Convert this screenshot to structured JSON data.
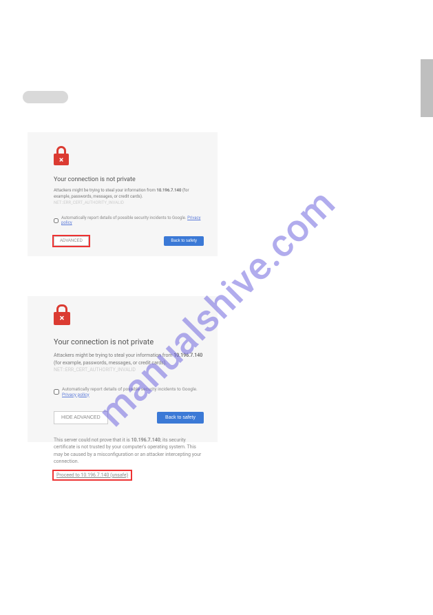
{
  "watermark": "manualshive.com",
  "panel1": {
    "heading": "Your connection is not private",
    "desc_pre": "Attackers might be trying to steal your information from ",
    "ip": "10.196.7.140",
    "desc_post": " (for example, passwords, messages, or credit cards). ",
    "errcode": "NET::ERR_CERT_AUTHORITY_INVALID",
    "check_label": "Automatically report details of possible security incidents to Google. ",
    "policy": "Privacy policy",
    "advanced": "ADVANCED",
    "safety": "Back to safety"
  },
  "panel2": {
    "heading": "Your connection is not private",
    "desc_pre": "Attackers might be trying to steal your information from ",
    "ip": "10.196.7.140",
    "desc_post": " (for example, passwords, messages, or credit cards). ",
    "errcode": "NET::ERR_CERT_AUTHORITY_INVALID",
    "check_label": "Automatically report details of possible security incidents to Google. ",
    "policy": "Privacy policy",
    "hide": "HIDE ADVANCED",
    "safety": "Back to safety",
    "explain_pre": "This server could not prove that it is ",
    "explain_ip": "10.196.7.140",
    "explain_post": "; its security certificate is not trusted by your computer's operating system. This may be caused by a misconfiguration or an attacker intercepting your connection.",
    "proceed": "Proceed to 10.196.7.140 (unsafe)"
  }
}
